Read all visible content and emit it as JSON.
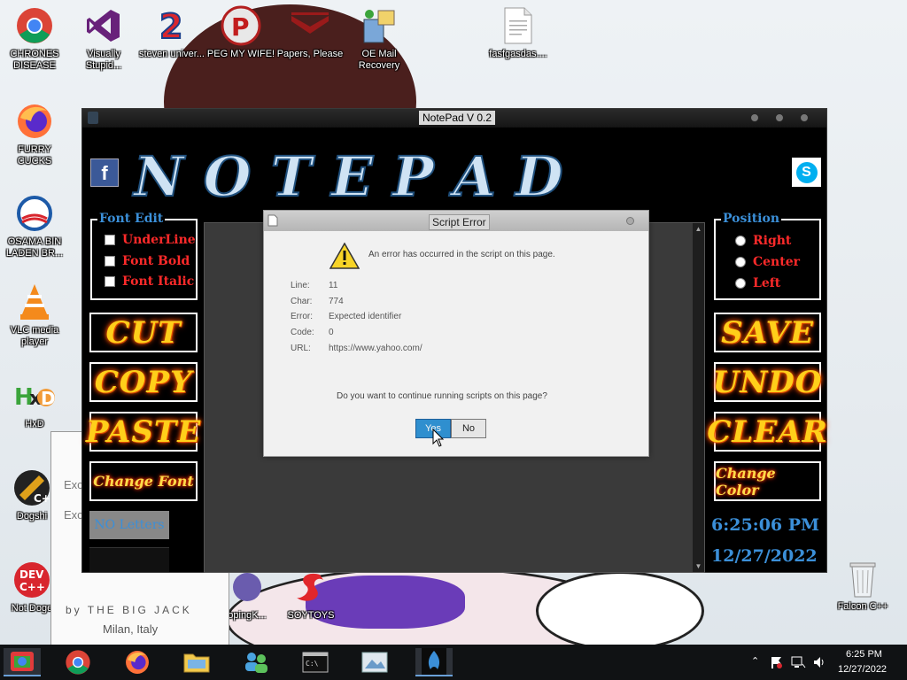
{
  "desktop": {
    "icons": [
      {
        "label": "CHRONES DISEASE",
        "icon": "chrome-icon"
      },
      {
        "label": "Visually Stupid...",
        "icon": "visual-studio-icon"
      },
      {
        "label": "steven univer...",
        "icon": "steven-universe-icon"
      },
      {
        "label": "PEG MY WIFE!",
        "icon": "p-badge-icon"
      },
      {
        "label": "Papers, Please",
        "icon": "papers-please-icon"
      },
      {
        "label": "OE Mail Recovery",
        "icon": "mail-recovery-icon"
      },
      {
        "label": "fasfgasdas....",
        "icon": "text-file-icon"
      },
      {
        "label": "FURRY CUCKS",
        "icon": "firefox-icon"
      },
      {
        "label": "OSAMA BIN LADEN BR...",
        "icon": "obama-logo-icon"
      },
      {
        "label": "VLC media player",
        "icon": "vlc-icon"
      },
      {
        "label": "HxD",
        "icon": "hxd-icon"
      },
      {
        "label": "Dogshi",
        "icon": "codeblocks-icon"
      },
      {
        "label": "Not Doge",
        "icon": "dev-cpp-icon"
      },
      {
        "label": "opingK...",
        "icon": "shortcut-icon"
      },
      {
        "label": "SOYTOYS",
        "icon": "soytoys-icon"
      },
      {
        "label": "Falcon C++",
        "icon": "recycle-bin-icon"
      }
    ]
  },
  "notepad": {
    "title": "NotePad V 0.2",
    "banner": [
      "N",
      "O",
      "T",
      "E",
      "P",
      "A",
      "D"
    ],
    "facebook_glyph": "f",
    "skype_glyph": "S",
    "font_edit": {
      "legend": "Font Edit",
      "options": [
        "UnderLine",
        "Font Bold",
        "Font Italic"
      ]
    },
    "position": {
      "legend": "Position",
      "options": [
        "Right",
        "Center",
        "Left"
      ]
    },
    "left_buttons": [
      "CUT",
      "COPY",
      "PASTE"
    ],
    "change_font": "Change Font",
    "right_buttons": [
      "SAVE",
      "UNDO",
      "CLEAR"
    ],
    "change_color": "Change Color",
    "no_letters": "NO Letters",
    "time": "6:25:06 PM",
    "date": "12/27/2022"
  },
  "dialog": {
    "title": "Script Error",
    "message": "An error has occurred in the script on this page.",
    "fields": [
      {
        "key": "Line:",
        "value": "11"
      },
      {
        "key": "Char:",
        "value": "774"
      },
      {
        "key": "Error:",
        "value": "Expected identifier"
      },
      {
        "key": "Code:",
        "value": "0"
      },
      {
        "key": "URL:",
        "value": "https://www.yahoo.com/"
      }
    ],
    "question": "Do you want to continue running scripts on this page?",
    "yes": "Yes",
    "no": "No"
  },
  "background_window": {
    "line1": "Exc",
    "line2": "Exc",
    "credit": "by THE BIG JACK",
    "location": "Milan, Italy"
  },
  "taskbar": {
    "time": "6:25 PM",
    "date": "12/27/2022",
    "items": [
      "file-explorer-colored-icon",
      "chrome-icon",
      "firefox-icon",
      "folder-icon",
      "people-icon",
      "cmd-icon",
      "image-viewer-icon",
      "app-flame-icon"
    ]
  },
  "colors": {
    "accent_blue": "#3b8fd8",
    "option_red": "#ff2a2a",
    "glow_yellow": "#ffcf1a",
    "yes_button": "#2f8fcf"
  }
}
